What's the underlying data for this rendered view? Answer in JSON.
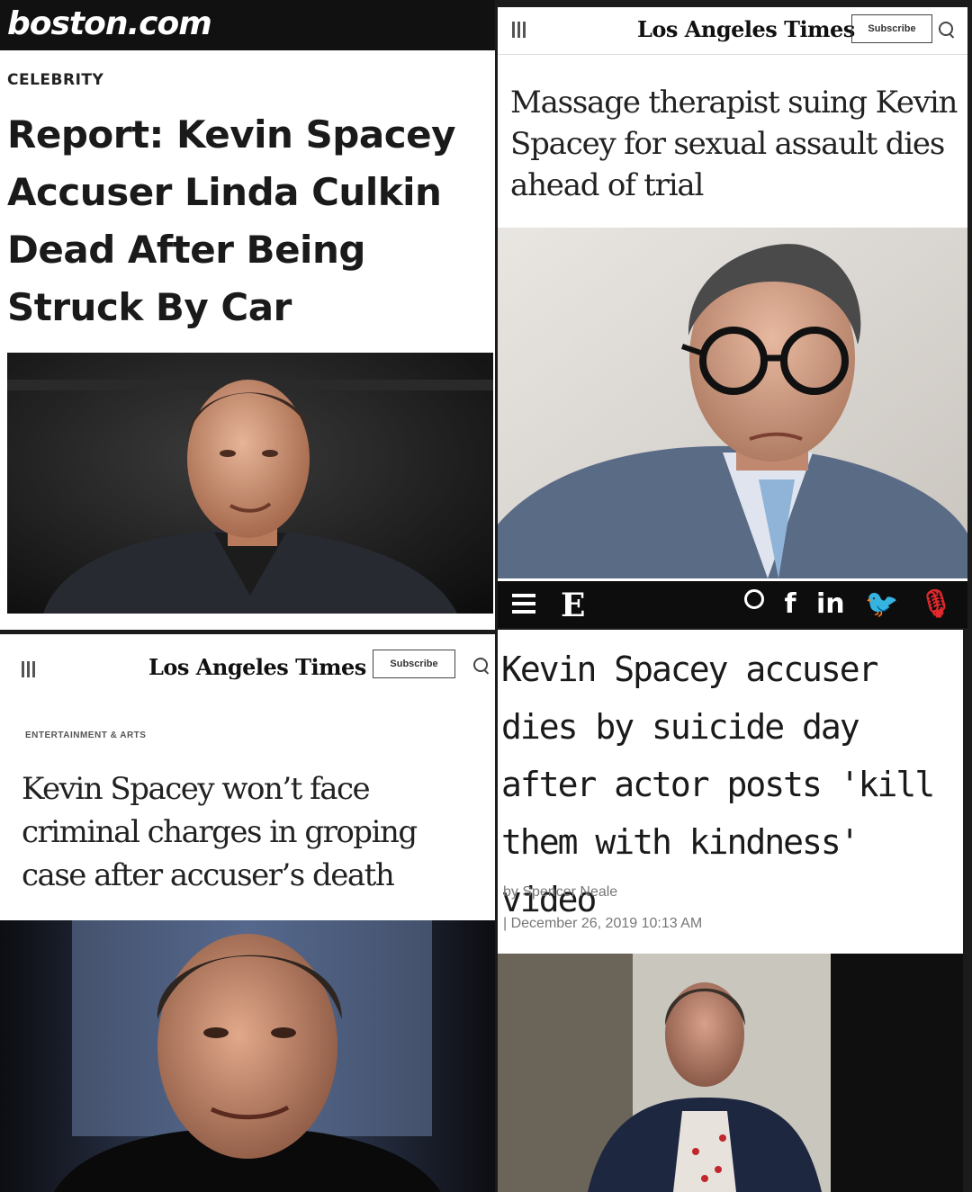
{
  "boston": {
    "logo": "boston.com",
    "section": "CELEBRITY",
    "headline": "Report: Kevin Spacey Accuser Linda Culkin Dead After Being Struck By Car"
  },
  "latimes_top": {
    "logo": "Los Angeles Times",
    "subscribe": "Subscribe",
    "headline": "Massage therapist suing Kevin Spacey for sexual assault dies ahead of trial"
  },
  "nav_bar": {
    "logo": "E",
    "icons": [
      "search-icon",
      "facebook-icon",
      "linkedin-icon",
      "twitter-icon",
      "microphone-icon"
    ],
    "facebook": "f",
    "linkedin": "in",
    "twitter": "🐦",
    "mic": "🎙"
  },
  "latimes_bottom": {
    "logo": "Los Angeles Times",
    "subscribe": "Subscribe",
    "section": "ENTERTAINMENT & ARTS",
    "headline": "Kevin Spacey won’t face criminal charges in groping case after accuser’s death"
  },
  "article4": {
    "headline": "Kevin Spacey accuser dies by suicide day after actor posts 'kill them with kindness' video",
    "byline": "by Spencer Neale",
    "date": "| December 26, 2019 10:13 AM"
  },
  "colors": {
    "accent_red": "#e0282e",
    "dark_bar": "#111111"
  }
}
